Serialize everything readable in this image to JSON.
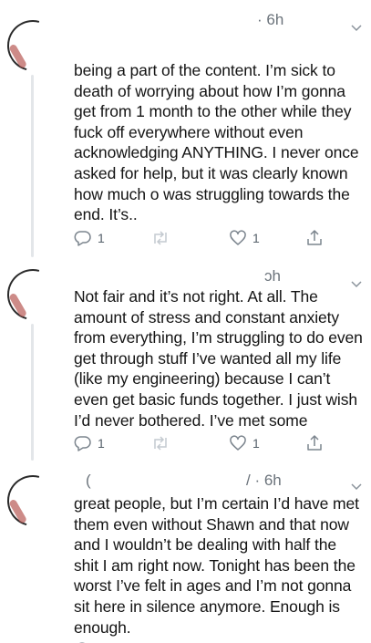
{
  "tweets": [
    {
      "time": "· 6h",
      "text": "being a part of the content. I’m sick to death of worrying about how I’m gonna get from 1 month to the other while they fuck off everywhere without even acknowledging ANYTHING. I never once asked for help, but it was clearly known how much o was struggling towards the end. It’s..",
      "reply_count": "1",
      "retweet_count": "",
      "like_count": "1"
    },
    {
      "time": "ɔh",
      "text": "Not fair and it’s not right. At all. The amount of stress and constant anxiety from everything, I’m struggling to do even get through stuff I’ve wanted all my life (like my engineering) because I can’t even get basic funds together. I just wish I’d never bothered. I’ve met some",
      "reply_count": "1",
      "retweet_count": "",
      "like_count": "1"
    },
    {
      "name_fragment": "(",
      "time": "/ · 6h",
      "text": "great people, but I’m certain I’d have met them even without Shawn and that now and I wouldn’t be dealing with half the shit I am right now. Tonight has been the worst I’ve felt in ages and I’m not gonna sit here in silence anymore. Enough is enough.",
      "reply_count": "",
      "retweet_count": "",
      "like_count": ""
    }
  ],
  "icons": {
    "reply": "reply-icon",
    "retweet": "retweet-icon",
    "like": "like-icon",
    "share": "share-icon",
    "caret": "chevron-down-icon"
  },
  "colors": {
    "text": "#141414",
    "meta": "#6b737b",
    "icon": "#7c858e",
    "thread_line": "#e3e6e9"
  }
}
